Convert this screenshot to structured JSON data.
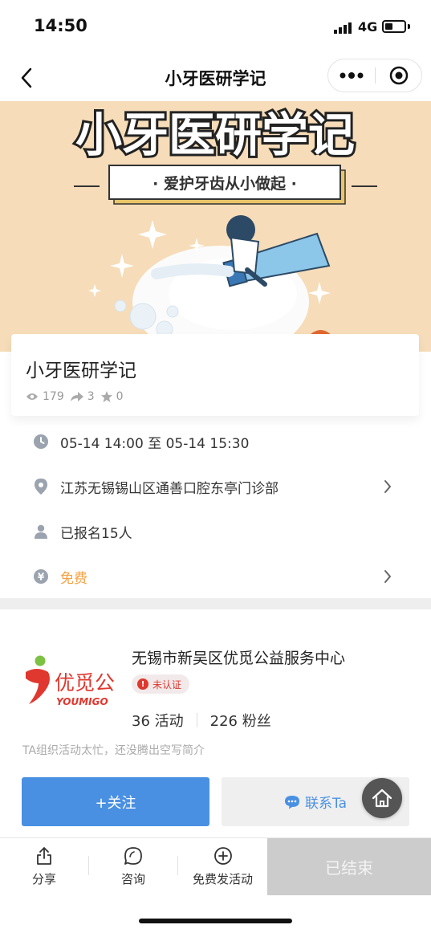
{
  "status_bar": {
    "time": "14:50",
    "network": "4G"
  },
  "nav": {
    "title": "小牙医研学记"
  },
  "banner": {
    "title": "小牙医研学记",
    "slogan": "· 爱护牙齿从小做起 ·"
  },
  "event": {
    "title": "小牙医研学记",
    "views": "179",
    "shares": "3",
    "stars": "0"
  },
  "details": {
    "time": "05-14 14:00 至 05-14 15:30",
    "location": "江苏无锡锡山区通善口腔东亭门诊部",
    "registered": "已报名15人",
    "price": "免费"
  },
  "organizer": {
    "logo_text": "优觅公",
    "logo_subtext": "YOUMIGO",
    "name": "无锡市新吴区优觅公益服务中心",
    "badge": "未认证",
    "activities": "36 活动",
    "fans": "226 粉丝",
    "intro": "TA组织活动太忙，还没腾出空写简介"
  },
  "actions": {
    "follow": "+关注",
    "contact": "联系Ta"
  },
  "bottom_bar": {
    "share": "分享",
    "consult": "咨询",
    "publish": "免费发活动",
    "ended": "已结束"
  },
  "colors": {
    "accent_blue": "#4a90e2",
    "price_orange": "#f5a142",
    "banner_bg": "#f6dcb8",
    "badge_red": "#e0372e"
  },
  "icons": {
    "back": "chevron-left-icon",
    "more": "more-dots-icon",
    "close": "target-circle-icon",
    "clock": "clock-icon",
    "location": "map-pin-icon",
    "person": "person-icon",
    "price": "yen-icon",
    "share": "share-icon",
    "consult": "chat-bubble-icon",
    "publish": "plus-circle-icon",
    "home": "home-icon"
  }
}
